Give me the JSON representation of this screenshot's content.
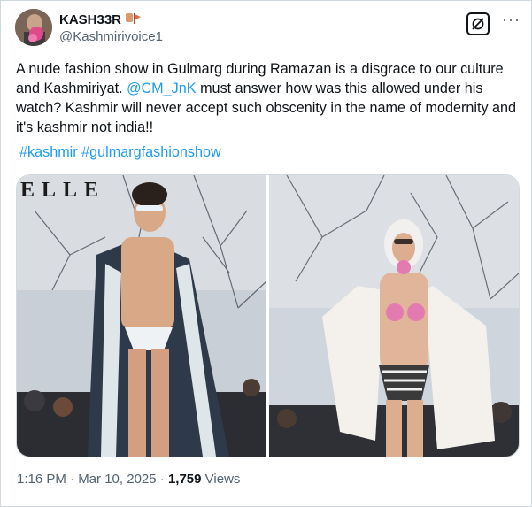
{
  "author": {
    "display_name": "KASH33R",
    "handle": "@Kashmirivoice1",
    "name_emoji": "flag-emoji"
  },
  "actions": {
    "grok_icon": "grok-icon",
    "more_icon": "more-options-icon",
    "more_glyph": "···"
  },
  "tweet": {
    "text_before_mention": "A nude fashion show in Gulmarg during Ramazan is a disgrace to our culture and Kashmiriyat. ",
    "mention": "@CM_JnK",
    "text_after_mention": " must answer how was this allowed under his watch? Kashmir will never accept such obscenity in the name of modernity and it's kashmir not india!!",
    "hashtag_1": "#kashmir",
    "hashtag_2": "#gulmargfashionshow"
  },
  "media": {
    "logo_text": "ELLE",
    "photos": [
      "runway-photo-male-model",
      "runway-photo-female-model"
    ]
  },
  "meta": {
    "time": "1:16 PM",
    "separator": " · ",
    "date": "Mar 10, 2025",
    "views_count": "1,759",
    "views_label": " Views"
  },
  "colors": {
    "accent": "#1d9bf0",
    "secondary_text": "#536471",
    "border": "#cfd9de"
  }
}
